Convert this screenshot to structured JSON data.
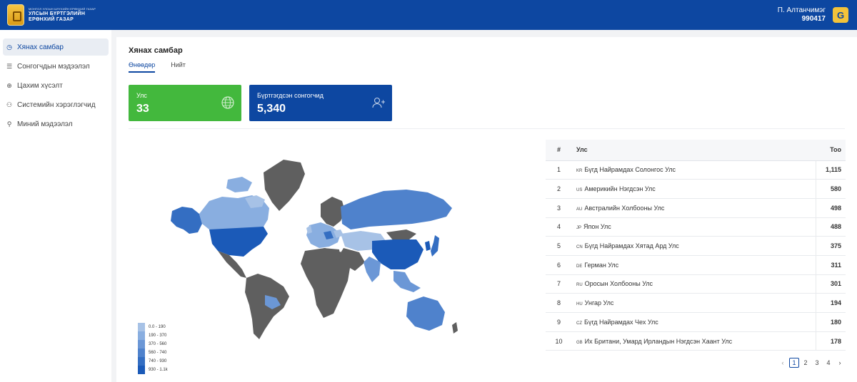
{
  "header": {
    "brand_small": "МОНГОЛ УЛСЫН ШҮҮХИЙН ЕРӨНХИЙ ГАЗАР",
    "brand_line1": "УЛСЫН БҮРТГЭЛИЙН",
    "brand_line2": "ЕРӨНХИЙ ГАЗАР",
    "user_name": "П. Алтанчимэг",
    "user_id": "990417",
    "user_button_icon": "G"
  },
  "sidebar": {
    "items": [
      {
        "label": "Хянах самбар",
        "icon": "dashboard-icon"
      },
      {
        "label": "Сонгогчдын мэдээлэл",
        "icon": "list-icon"
      },
      {
        "label": "Цахим хүсэлт",
        "icon": "globe-icon"
      },
      {
        "label": "Системийн хэрэглэгчид",
        "icon": "users-icon"
      },
      {
        "label": "Миний мэдээлэл",
        "icon": "user-icon"
      }
    ]
  },
  "main": {
    "title": "Хянах самбар",
    "tabs": [
      {
        "label": "Өнөөдөр"
      },
      {
        "label": "Нийт"
      }
    ],
    "cards": {
      "countries": {
        "label": "Улс",
        "value": "33",
        "icon": "globe-icon",
        "color": "#43b83d"
      },
      "voters": {
        "label": "Бүртгэгдсэн сонгогчид",
        "value": "5,340",
        "icon": "users-icon",
        "color": "#0d47a1"
      }
    },
    "legend": [
      {
        "label": "0.0 - 190",
        "color": "#a7c2e6"
      },
      {
        "label": "190 - 370",
        "color": "#89aee0"
      },
      {
        "label": "370 - 560",
        "color": "#6b97d6"
      },
      {
        "label": "560 - 740",
        "color": "#4f82cc"
      },
      {
        "label": "740 - 930",
        "color": "#346ec2"
      },
      {
        "label": "930 - 1.1k",
        "color": "#1b5ab8"
      }
    ],
    "table": {
      "headers": [
        "#",
        "Улс",
        "Тоо"
      ],
      "rows": [
        {
          "num": "1",
          "code": "KR",
          "country": "Бүгд Найрамдах Солонгос Улс",
          "count": "1,115"
        },
        {
          "num": "2",
          "code": "US",
          "country": "Америкийн Нэгдсэн Улс",
          "count": "580"
        },
        {
          "num": "3",
          "code": "AU",
          "country": "Австралийн Холбооны Улс",
          "count": "498"
        },
        {
          "num": "4",
          "code": "JP",
          "country": "Япон Улс",
          "count": "488"
        },
        {
          "num": "5",
          "code": "CN",
          "country": "Бүгд Найрамдах Хятад Ард Улс",
          "count": "375"
        },
        {
          "num": "6",
          "code": "DE",
          "country": "Герман Улс",
          "count": "311"
        },
        {
          "num": "7",
          "code": "RU",
          "country": "Оросын Холбооны Улс",
          "count": "301"
        },
        {
          "num": "8",
          "code": "HU",
          "country": "Унгар Улс",
          "count": "194"
        },
        {
          "num": "9",
          "code": "CZ",
          "country": "Бүгд Найрамдах Чех Улс",
          "count": "180"
        },
        {
          "num": "10",
          "code": "GB",
          "country": "Их Британи, Умард Ирландын Нэгдсэн Хаант Улс",
          "count": "178"
        }
      ]
    },
    "pagination": {
      "prev": "‹",
      "pages": [
        "1",
        "2",
        "3",
        "4"
      ],
      "current": "1",
      "next": "›"
    }
  }
}
